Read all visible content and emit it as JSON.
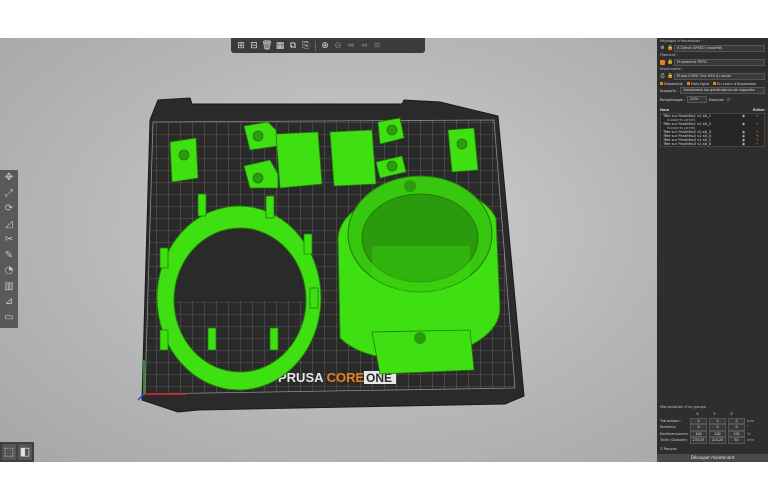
{
  "toolbar": {
    "items": [
      {
        "icon": "add-icon",
        "label": "⊞"
      },
      {
        "icon": "delete-icon",
        "label": "⊟"
      },
      {
        "icon": "delete-all-icon",
        "label": "🗑"
      },
      {
        "icon": "arrange-icon",
        "label": "▦"
      },
      {
        "icon": "copy-icon",
        "label": "⧉"
      },
      {
        "icon": "paste-icon",
        "label": "⎘"
      },
      {
        "icon": "add-instance-icon",
        "label": "⊕"
      },
      {
        "icon": "remove-instance-icon",
        "label": "⊖"
      },
      {
        "icon": "split-objects-icon",
        "label": "⇹"
      },
      {
        "icon": "split-parts-icon",
        "label": "⇸"
      },
      {
        "icon": "layers-editing-icon",
        "label": "≡"
      }
    ]
  },
  "left_tools": [
    "move-icon",
    "scale-icon",
    "rotate-icon",
    "place-on-face-icon",
    "cut-icon",
    "paint-supports-icon",
    "seam-icon",
    "fdm-supports-icon",
    "measure-icon",
    "emboss-icon"
  ],
  "printer_brand": {
    "part1": "PRUSA ",
    "part2": "CORE ",
    "part3": "ONE"
  },
  "panel": {
    "print_settings_label": "Réglages d'impression :",
    "print_settings_value": "0.20mm SPEED (modifié)",
    "filament_label": "Filament :",
    "filament_value": "Prusament PETG",
    "printer_label": "Imprimante :",
    "printer_value": "Prusa CORE One HF0.4 nozzle",
    "checks": [
      "Disponible",
      "Hors ligne",
      "En cours d'impression"
    ],
    "supports_label": "Supports :",
    "supports_value": "Seulement les générateurs de supports",
    "infill_label": "Remplissage :",
    "infill_value": "20%",
    "brim_label": "Bordure:",
    "list_header_name": "Nom",
    "list_header_edit": "Éditer",
    "objects": [
      {
        "name": "Tête sur Parallélo1 v2.stl_1",
        "sub": false
      },
      {
        "name": "Supports peints",
        "sub": true
      },
      {
        "name": "Tête sur Parallélo1 v2.stl_2",
        "sub": false
      },
      {
        "name": "Supports peints",
        "sub": true
      },
      {
        "name": "Tête sur Parallélo2 v2.stl_3",
        "sub": false
      },
      {
        "name": "Tête sur Parallélo2 v2.stl_4",
        "sub": false
      },
      {
        "name": "Tête sur Parallélo3 v2.stl_5",
        "sub": false
      },
      {
        "name": "Tête sur Parallélo3 v2.stl_6",
        "sub": false
      }
    ],
    "manipulation_title": "Manipulation d'un groupe",
    "axes": [
      "X",
      "Y",
      "Z"
    ],
    "translation_label": "Translation:",
    "translation_values": [
      "0",
      "0",
      "0"
    ],
    "rotation_label": "Rotation:",
    "rotation_values": [
      "0",
      "0",
      "0"
    ],
    "scale_label": "Redimensionner:",
    "scale_values": [
      "100",
      "100",
      "100"
    ],
    "size_label": "Taille (Globale):",
    "size_values": [
      "233.53",
      "214.25",
      "50"
    ],
    "unit_mm": "mm",
    "unit_deg": "°",
    "unit_pct": "%",
    "inches_label": "Pouces",
    "slice_button": "Découper maintenant"
  },
  "colors": {
    "panel_bg": "#2e2e2e",
    "accent": "#ef7f1a",
    "model_green": "#3fe012",
    "bed": "#2b2b2b"
  }
}
